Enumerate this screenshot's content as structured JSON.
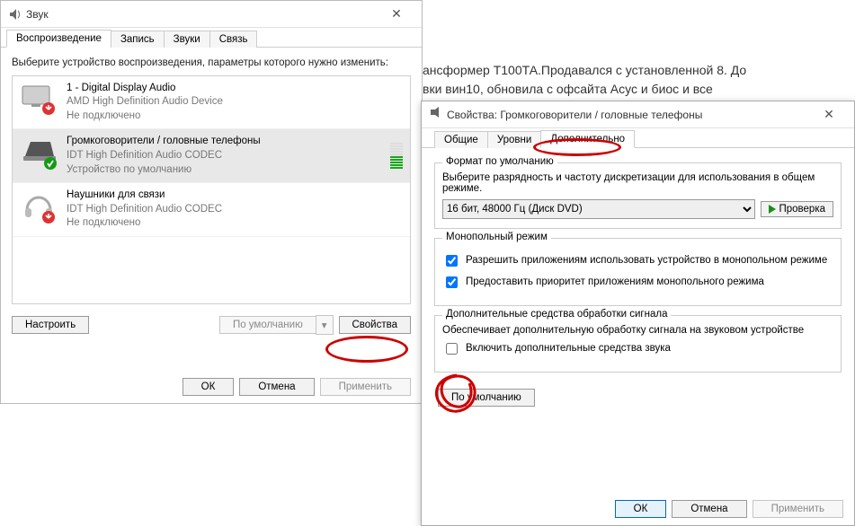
{
  "background_text_line1": "ансформер Т100ТА.Продавался с установленной 8. До",
  "background_text_line2": "вки вин10, обновила с офсайта Асус и биос и все",
  "sound_window": {
    "title": "Звук",
    "tabs": {
      "playback": "Воспроизведение",
      "recording": "Запись",
      "sounds": "Звуки",
      "comm": "Связь"
    },
    "instruction": "Выберите устройство воспроизведения, параметры которого нужно изменить:",
    "devices": [
      {
        "title": "1 - Digital Display Audio",
        "sub": "AMD High Definition Audio Device",
        "status": "Не подключено"
      },
      {
        "title": "Громкоговорители / головные телефоны",
        "sub": "IDT High Definition Audio CODEC",
        "status": "Устройство по умолчанию"
      },
      {
        "title": "Наушники для связи",
        "sub": "IDT High Definition Audio CODEC",
        "status": "Не подключено"
      }
    ],
    "buttons": {
      "configure": "Настроить",
      "set_default": "По умолчанию",
      "properties": "Свойства",
      "ok": "ОК",
      "cancel": "Отмена",
      "apply": "Применить"
    }
  },
  "props_window": {
    "title": "Свойства: Громкоговорители / головные телефоны",
    "tabs": {
      "general": "Общие",
      "levels": "Уровни",
      "advanced": "Дополнительно"
    },
    "default_format": {
      "legend": "Формат по умолчанию",
      "desc": "Выберите разрядность и частоту дискретизации для использования в общем режиме.",
      "value": "16 бит, 48000 Гц (Диск DVD)",
      "test": "Проверка"
    },
    "exclusive": {
      "legend": "Монопольный режим",
      "opt1": "Разрешить приложениям использовать устройство в монопольном режиме",
      "opt2": "Предоставить приоритет приложениям монопольного режима"
    },
    "enhance": {
      "legend": "Дополнительные средства обработки сигнала",
      "desc": "Обеспечивает дополнительную обработку сигнала на звуковом устройстве",
      "opt": "Включить дополнительные средства звука"
    },
    "restore": "По умолчанию",
    "buttons": {
      "ok": "ОК",
      "cancel": "Отмена",
      "apply": "Применить"
    }
  }
}
